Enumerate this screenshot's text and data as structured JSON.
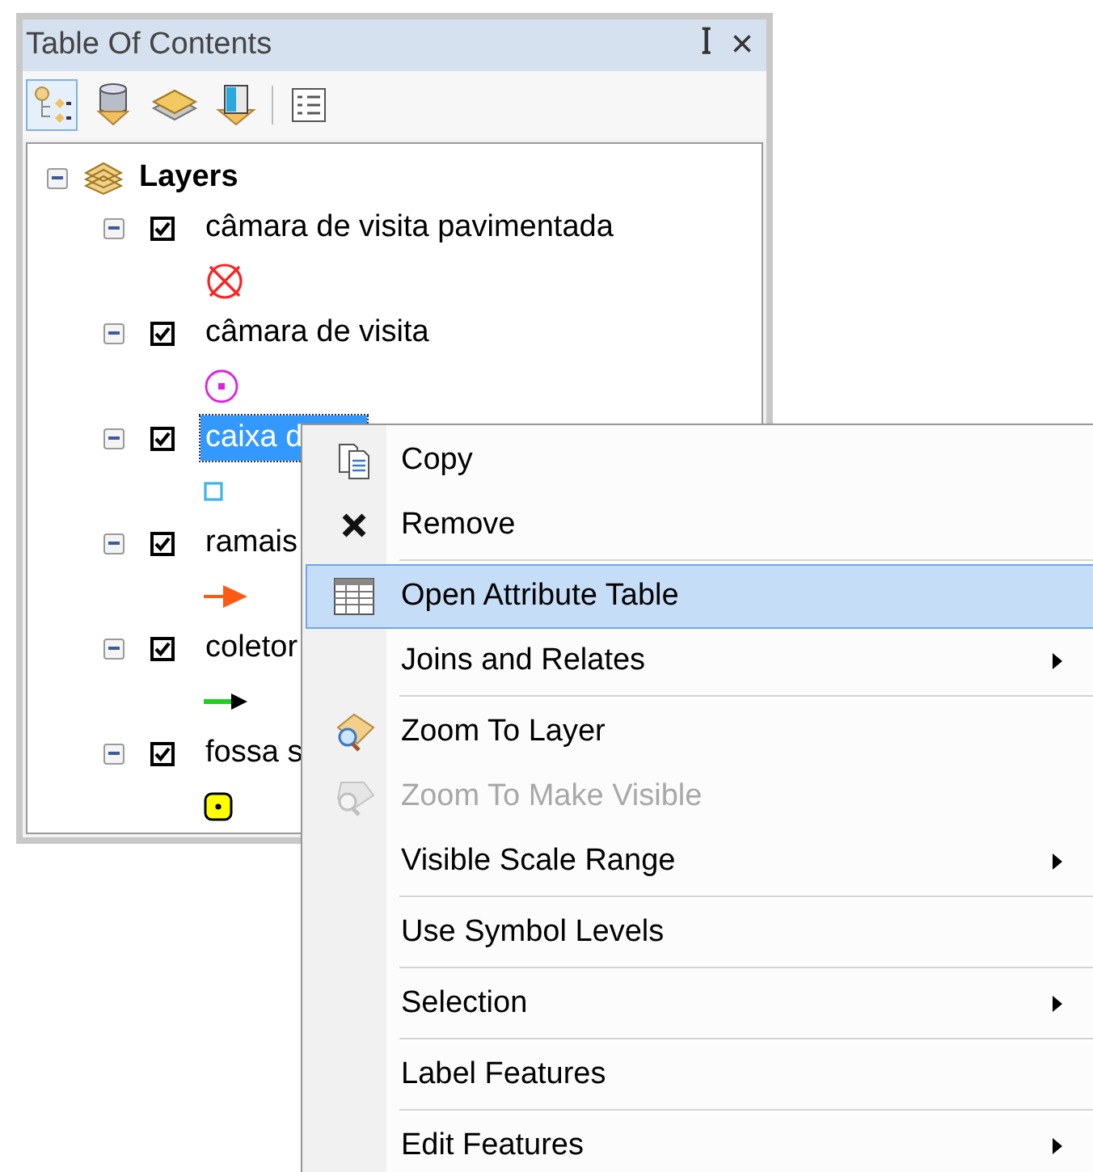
{
  "window": {
    "title": "Table Of Contents",
    "pin": "ꟾ",
    "close": "×"
  },
  "tools": [
    {
      "kind": "drawing-order",
      "selected": true
    },
    {
      "kind": "source",
      "selected": false
    },
    {
      "kind": "visibility",
      "selected": false
    },
    {
      "kind": "selection",
      "selected": false
    },
    {
      "kind": "options",
      "selected": false
    }
  ],
  "tree": {
    "label": "Layers",
    "expanded": true,
    "children": [
      {
        "name": "câmara de visita pavimentada",
        "checked": true,
        "expanded": true,
        "selected": false,
        "kind": "crossed-circle",
        "color": "#ff2020"
      },
      {
        "name": "câmara de visita",
        "checked": true,
        "expanded": true,
        "selected": false,
        "kind": "dot-circle",
        "color": "#e020e0"
      },
      {
        "name": "caixa d",
        "checked": true,
        "expanded": true,
        "selected": true,
        "kind": "square",
        "color": "#3cb4f0"
      },
      {
        "name": "ramais",
        "checked": true,
        "expanded": true,
        "selected": false,
        "kind": "arrow",
        "color": "#ff5a14"
      },
      {
        "name": "coletor",
        "checked": true,
        "expanded": true,
        "selected": false,
        "kind": "line-arrow",
        "color": "#20d020"
      },
      {
        "name": "fossa s",
        "checked": true,
        "expanded": true,
        "selected": false,
        "kind": "dot-square",
        "color": "#ffff00"
      }
    ]
  },
  "context_menu": [
    {
      "label": "Copy",
      "kind": "copy",
      "selected": false,
      "disabled": false,
      "submenu": false,
      "divider_after": false
    },
    {
      "label": "Remove",
      "kind": "remove",
      "selected": false,
      "disabled": false,
      "submenu": false,
      "divider_after": true
    },
    {
      "label": "Open Attribute Table",
      "kind": "table",
      "selected": true,
      "disabled": false,
      "submenu": false,
      "divider_after": false
    },
    {
      "label": "Joins and Relates",
      "selected": false,
      "disabled": false,
      "submenu": true,
      "divider_after": true
    },
    {
      "label": "Zoom To Layer",
      "kind": "zoom",
      "selected": false,
      "disabled": false,
      "submenu": false,
      "divider_after": false
    },
    {
      "label": "Zoom To Make Visible",
      "kind": "zoom",
      "selected": false,
      "disabled": true,
      "submenu": false,
      "divider_after": false
    },
    {
      "label": "Visible Scale Range",
      "selected": false,
      "disabled": false,
      "submenu": true,
      "divider_after": true
    },
    {
      "label": "Use Symbol Levels",
      "selected": false,
      "disabled": false,
      "submenu": false,
      "divider_after": true
    },
    {
      "label": "Selection",
      "selected": false,
      "disabled": false,
      "submenu": true,
      "divider_after": true
    },
    {
      "label": "Label Features",
      "selected": false,
      "disabled": false,
      "submenu": false,
      "divider_after": true
    },
    {
      "label": "Edit Features",
      "selected": false,
      "disabled": false,
      "submenu": true,
      "divider_after": false
    }
  ]
}
